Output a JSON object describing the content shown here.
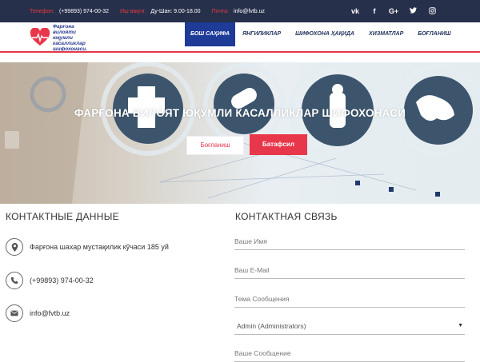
{
  "topbar": {
    "phone_label": "Телефон:",
    "phone_value": "(+99893) 974-00-32",
    "hours_label": "Иш вақти:",
    "hours_value": "Ду-Шан: 9.00-18.00",
    "mail_label": "Почта:",
    "mail_value": "info@fvtb.uz",
    "socials": [
      "vk",
      "f",
      "G+",
      "twitter",
      "instagram"
    ]
  },
  "logo": {
    "line1": "Фарғона вилояти",
    "line2": "юқумли касалликлар",
    "line3": "шифохонаси."
  },
  "menu": [
    {
      "label": "БОШ САҲИФА",
      "active": true
    },
    {
      "label": "ЯНГИЛИКЛАР",
      "active": false
    },
    {
      "label": "ШИФОХОНА ҲАҚИДА",
      "active": false
    },
    {
      "label": "ХИЗМАТЛАР",
      "active": false
    },
    {
      "label": "БОҒЛАНИШ",
      "active": false
    }
  ],
  "hero": {
    "title": "ФАРҒОНА ВИЛОЯТ ЮҚУМЛИ КАСАЛЛИКЛАР ШИФОХОНАСИ",
    "btn_contact": "Боғланиш",
    "btn_details": "Батафсил"
  },
  "contact_data": {
    "title": "КОНТАКТНЫЕ ДАННЫЕ",
    "address": "Фарғона шахар мустақилик кўчаси 185 уй",
    "phone": "(+99893) 974-00-32",
    "email": "info@fvtb.uz"
  },
  "contact_form": {
    "title": "КОНТАКТНАЯ СВЯЗЬ",
    "name_placeholder": "Ваше Имя",
    "email_placeholder": "Ваш E-Mail",
    "subject_placeholder": "Тема Сообщения",
    "recipient_selected": "Admin (Administrators)",
    "message_placeholder": "Ваше Сообщение"
  },
  "colors": {
    "topbar_bg": "#27304b",
    "accent_red": "#e8374a",
    "nav_active": "#1f3b98"
  }
}
